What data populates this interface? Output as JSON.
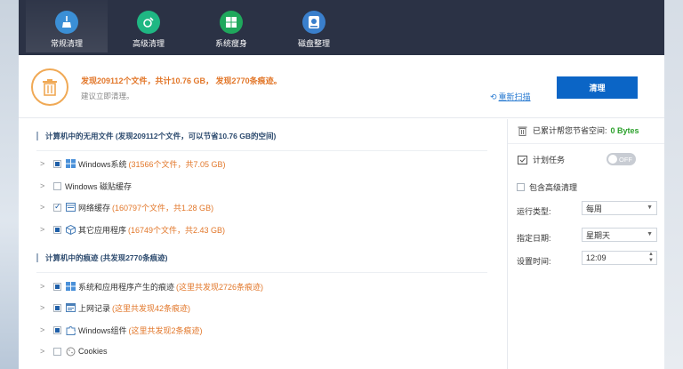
{
  "tabs": [
    {
      "label": "常规清理",
      "icon": "broom-icon",
      "color": "#3b8fd6",
      "active": true
    },
    {
      "label": "高级清理",
      "icon": "advanced-clean-icon",
      "color": "#1fb783",
      "active": false
    },
    {
      "label": "系统瘦身",
      "icon": "windows-icon",
      "color": "#1fa85c",
      "active": false
    },
    {
      "label": "磁盘整理",
      "icon": "disk-icon",
      "color": "#3a7fcc",
      "active": false
    }
  ],
  "summary": {
    "main_text": "发现209112个文件，共计10.76 GB， 发现2770条痕迹。",
    "sub_text": "建议立即清理。",
    "rescan_label": "重新扫描",
    "clean_label": "清理"
  },
  "junk_section": {
    "title": "计算机中的无用文件 (发现209112个文件，可以节省10.76 GB的空间)",
    "items": [
      {
        "label": "Windows系统",
        "detail": "(31566个文件，共7.05 GB)",
        "check": "partial",
        "icon": "windows-icon"
      },
      {
        "label": "Windows 磁贴缓存",
        "detail": "",
        "check": "unchecked",
        "icon": ""
      },
      {
        "label": "网络缓存",
        "detail": "(160797个文件，共1.28 GB)",
        "check": "checked",
        "icon": "browser-cache-icon"
      },
      {
        "label": "其它应用程序",
        "detail": "(16749个文件，共2.43 GB)",
        "check": "partial",
        "icon": "box-icon"
      }
    ]
  },
  "traces_section": {
    "title": "计算机中的痕迹 (共发现2770条痕迹)",
    "items": [
      {
        "label": "系统和应用程序产生的痕迹",
        "detail": "(这里共发现2726条痕迹)",
        "check": "partial",
        "icon": "windows-icon"
      },
      {
        "label": "上网记录",
        "detail": "(这里共发现42条痕迹)",
        "check": "partial",
        "icon": "browser-history-icon"
      },
      {
        "label": "Windows组件",
        "detail": "(这里共发现2条痕迹)",
        "check": "partial",
        "icon": "puzzle-icon"
      },
      {
        "label": "Cookies",
        "detail": "",
        "check": "unchecked",
        "icon": "cookie-icon"
      }
    ]
  },
  "right_panel": {
    "saved_label": "已累计帮您节省空间:",
    "saved_value": "0 Bytes",
    "schedule_label": "计划任务",
    "toggle_text": "OFF",
    "include_advanced_label": "包含高级清理",
    "run_type_label": "运行类型:",
    "run_type_value": "每周",
    "date_label": "指定日期:",
    "date_value": "星期天",
    "time_label": "设置时间:",
    "time_value": "12:09"
  },
  "colors": {
    "topbar": "#2b3245",
    "accent_orange": "#e2772a",
    "primary_blue": "#0b65c6",
    "green": "#2ca12c"
  }
}
